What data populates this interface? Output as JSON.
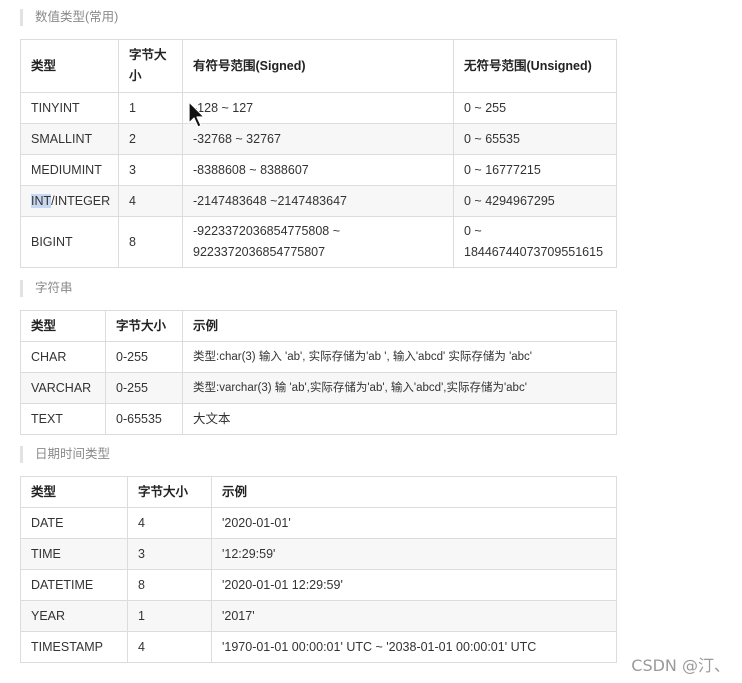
{
  "numeric": {
    "title": "数值类型(常用)",
    "headers": [
      "类型",
      "字节大小",
      "有符号范围(Signed)",
      "无符号范围(Unsigned)"
    ],
    "header_byte_line1": "字节大",
    "header_byte_line2": "小",
    "rows": [
      [
        "TINYINT",
        "1",
        "-128 ~ 127",
        "0 ~ 255"
      ],
      [
        "SMALLINT",
        "2",
        "-32768 ~ 32767",
        "0 ~ 65535"
      ],
      [
        "MEDIUMINT",
        "3",
        "-8388608 ~ 8388607",
        "0 ~ 16777215"
      ],
      [
        "INT/INTEGER",
        "4",
        "-2147483648 ~2147483647",
        "0 ~ 4294967295"
      ],
      [
        "BIGINT",
        "8",
        "-9223372036854775808 ~",
        "0 ~"
      ]
    ],
    "int_highlight": "INT",
    "int_rest": "/INTEGER",
    "bigint_signed_line2": "9223372036854775807",
    "bigint_unsigned_line2": "18446744073709551615"
  },
  "string": {
    "title": "字符串",
    "headers": [
      "类型",
      "字节大小",
      "示例"
    ],
    "rows": [
      [
        "CHAR",
        "0-255",
        "类型:char(3) 输入 'ab', 实际存储为'ab ', 输入'abcd' 实际存储为 'abc'"
      ],
      [
        "VARCHAR",
        "0-255",
        "类型:varchar(3) 输 'ab',实际存储为'ab', 输入'abcd',实际存储为'abc'"
      ],
      [
        "TEXT",
        "0-65535",
        "大文本"
      ]
    ]
  },
  "datetime": {
    "title": "日期时间类型",
    "headers": [
      "类型",
      "字节大小",
      "示例"
    ],
    "rows": [
      [
        "DATE",
        "4",
        "'2020-01-01'"
      ],
      [
        "TIME",
        "3",
        "'12:29:59'"
      ],
      [
        "DATETIME",
        "8",
        "'2020-01-01 12:29:59'"
      ],
      [
        "YEAR",
        "1",
        "'2017'"
      ],
      [
        "TIMESTAMP",
        "4",
        "'1970-01-01 00:00:01' UTC ~ '2038-01-01 00:00:01' UTC"
      ]
    ]
  },
  "watermark": "CSDN @汀、",
  "icons": {
    "cursor": "mouse-pointer-icon"
  }
}
